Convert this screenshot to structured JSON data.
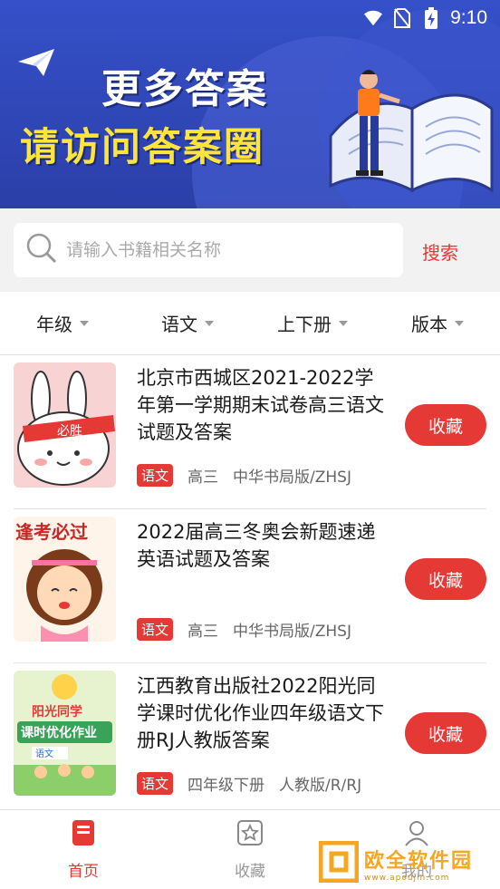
{
  "status_bar": {
    "time": "9:10"
  },
  "banner": {
    "headline_1": "更多答案",
    "headline_2": "请访问答案圈"
  },
  "search": {
    "placeholder": "请输入书籍相关名称",
    "button_label": "搜索"
  },
  "filters": [
    {
      "label": "年级"
    },
    {
      "label": "语文"
    },
    {
      "label": "上下册"
    },
    {
      "label": "版本"
    }
  ],
  "books": [
    {
      "title": "北京市西城区2021-2022学年第一学期期末试卷高三语文试题及答案",
      "subject": "语文",
      "grade": "高三",
      "edition": "中华书局版/ZHSJ",
      "fav_label": "收藏",
      "cover_text": "必胜"
    },
    {
      "title": "2022届高三冬奥会新题速递英语试题及答案",
      "subject": "语文",
      "grade": "高三",
      "edition": "中华书局版/ZHSJ",
      "fav_label": "收藏",
      "cover_text": "逢考必过"
    },
    {
      "title": "江西教育出版社2022阳光同学课时优化作业四年级语文下册RJ人教版答案",
      "subject": "语文",
      "grade": "四年级下册",
      "edition": "人教版/R/RJ",
      "fav_label": "收藏",
      "cover_text_1": "阳光同学",
      "cover_text_2": "课时优化作业",
      "cover_text_3": "语文"
    }
  ],
  "bottom_nav": [
    {
      "label": "首页",
      "icon": "book-icon",
      "active": true
    },
    {
      "label": "收藏",
      "icon": "star-icon",
      "active": false
    },
    {
      "label": "我的",
      "icon": "user-icon",
      "active": false
    }
  ],
  "watermark": {
    "text": "欧全软件园",
    "sub": "www.apoujin.com"
  },
  "colors": {
    "accent": "#e53935",
    "banner_blue": "#3550c9",
    "banner_yellow": "#ffe43a"
  }
}
